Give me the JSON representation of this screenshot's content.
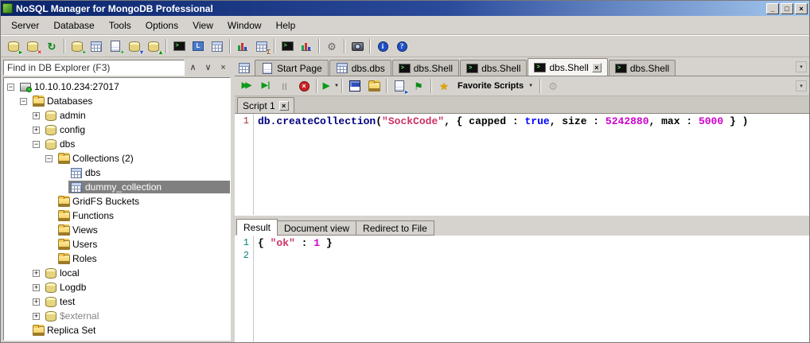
{
  "window": {
    "title": "NoSQL Manager for MongoDB Professional",
    "controls": [
      {
        "name": "minimize",
        "glyph": "_"
      },
      {
        "name": "maximize",
        "glyph": "□"
      },
      {
        "name": "close",
        "glyph": "×"
      }
    ]
  },
  "menu": {
    "items": [
      "Server",
      "Database",
      "Tools",
      "Options",
      "View",
      "Window",
      "Help"
    ]
  },
  "toolbar": {
    "items": [
      {
        "name": "connect-server",
        "base": "db",
        "badge": "▸",
        "badge_color": "#009900"
      },
      {
        "name": "disconnect-server",
        "base": "db",
        "badge": "×",
        "badge_color": "#cc0000"
      },
      {
        "name": "refresh-explorer",
        "base": "refresh",
        "glyph": "↻"
      },
      {
        "sep": true
      },
      {
        "name": "new-database",
        "base": "db",
        "badge": "+",
        "badge_color": "#009900"
      },
      {
        "name": "open-collection",
        "base": "grid"
      },
      {
        "name": "new-query",
        "base": "doc",
        "badge": "+",
        "badge_color": "#009900"
      },
      {
        "name": "import-data",
        "base": "db",
        "badge": "▾",
        "badge_color": "#2255cc"
      },
      {
        "name": "export-data",
        "base": "db",
        "badge": "▴",
        "badge_color": "#009900"
      },
      {
        "sep": true
      },
      {
        "name": "open-shell",
        "base": "monitor",
        "glyph": ">"
      },
      {
        "name": "linq-query",
        "base": "linq",
        "glyph": "L"
      },
      {
        "name": "view-documents",
        "base": "grid"
      },
      {
        "sep": true
      },
      {
        "name": "map-reduce",
        "base": "chart"
      },
      {
        "name": "aggregate",
        "base": "grid",
        "badge": "Σ",
        "badge_color": "#884400"
      },
      {
        "sep": true
      },
      {
        "name": "server-monitoring",
        "base": "monitor",
        "glyph": ">"
      },
      {
        "name": "server-status",
        "base": "chart"
      },
      {
        "sep": true
      },
      {
        "name": "options",
        "base": "gear",
        "glyph": "⚙"
      },
      {
        "sep": true
      },
      {
        "name": "screenshot",
        "base": "camera"
      },
      {
        "sep": true
      },
      {
        "name": "about",
        "base": "info",
        "glyph": "i"
      },
      {
        "name": "help",
        "base": "help",
        "glyph": "?"
      }
    ]
  },
  "explorer": {
    "search_placeholder": "Find in DB Explorer (F3)",
    "buttons": [
      {
        "name": "find-previous",
        "glyph": "∧"
      },
      {
        "name": "find-next",
        "glyph": "∨"
      },
      {
        "name": "search-close",
        "glyph": "×"
      }
    ],
    "tree": [
      {
        "label": "10.10.10.234:27017",
        "icon": "server",
        "expand": "-",
        "depth": 0
      },
      {
        "label": "Databases",
        "icon": "folder",
        "expand": "-",
        "depth": 1
      },
      {
        "label": "admin",
        "icon": "db",
        "expand": "+",
        "depth": 2
      },
      {
        "label": "config",
        "icon": "db",
        "expand": "+",
        "depth": 2
      },
      {
        "label": "dbs",
        "icon": "db",
        "expand": "-",
        "depth": 2
      },
      {
        "label": "Collections (2)",
        "icon": "folder",
        "expand": "-",
        "depth": 3
      },
      {
        "label": "dbs",
        "icon": "grid",
        "depth": 4
      },
      {
        "label": "dummy_collection",
        "icon": "grid",
        "depth": 4,
        "selected": true
      },
      {
        "label": "GridFS Buckets",
        "icon": "folder",
        "depth": 3
      },
      {
        "label": "Functions",
        "icon": "folder",
        "depth": 3
      },
      {
        "label": "Views",
        "icon": "folder",
        "depth": 3
      },
      {
        "label": "Users",
        "icon": "folder",
        "depth": 3
      },
      {
        "label": "Roles",
        "icon": "folder",
        "depth": 3
      },
      {
        "label": "local",
        "icon": "db",
        "expand": "+",
        "depth": 2
      },
      {
        "label": "Logdb",
        "icon": "db",
        "expand": "+",
        "depth": 2
      },
      {
        "label": "test",
        "icon": "db",
        "expand": "+",
        "depth": 2
      },
      {
        "label": "$external",
        "icon": "db",
        "expand": "+",
        "depth": 2,
        "muted": true
      },
      {
        "label": "Replica Set",
        "icon": "folder",
        "depth": 1
      }
    ]
  },
  "tabs": {
    "overflow_glyph": "▾",
    "items": [
      {
        "label": "Start Page",
        "icon": "doc"
      },
      {
        "label": "dbs.dbs",
        "icon": "grid"
      },
      {
        "label": "dbs.Shell",
        "icon": "monitor"
      },
      {
        "label": "dbs.Shell",
        "icon": "monitor"
      },
      {
        "label": "dbs.Shell",
        "icon": "monitor",
        "active": true,
        "closable": true
      },
      {
        "label": "dbs.Shell",
        "icon": "monitor"
      }
    ]
  },
  "shell": {
    "script_tab_label": "Script 1",
    "overflow_glyph": "▾",
    "toolbar": [
      {
        "name": "execute-script",
        "base": "playplay",
        "glyph": "▶▶"
      },
      {
        "name": "execute-statement",
        "base": "playbar",
        "glyph": "▶|"
      },
      {
        "name": "pause-script",
        "base": "pause",
        "glyph": "||"
      },
      {
        "name": "stop-script",
        "base": "stop",
        "glyph": "×"
      },
      {
        "sep": true
      },
      {
        "name": "execute-with-options",
        "base": "play",
        "glyph": "▶",
        "dropdown": true
      },
      {
        "sep": true
      },
      {
        "name": "save-script",
        "base": "floppy"
      },
      {
        "name": "open-script",
        "base": "folder"
      },
      {
        "sep": true
      },
      {
        "name": "export-result",
        "base": "doc",
        "badge": "▸",
        "badge_color": "#2255cc"
      },
      {
        "name": "run-to-flag",
        "base": "flag",
        "glyph": "⚑"
      },
      {
        "sep": true
      },
      {
        "name": "add-to-favorites",
        "base": "star",
        "glyph": "★"
      },
      {
        "name": "favorite-scripts",
        "label": "Favorite Scripts",
        "dropdown": true
      },
      {
        "sep": true
      },
      {
        "name": "shell-options",
        "base": "gear",
        "glyph": "⚙",
        "disabled": true
      }
    ]
  },
  "editor": {
    "line_numbers": [
      "1"
    ],
    "tokens": [
      {
        "t": "db.createCollection",
        "c": "ident"
      },
      {
        "t": "(",
        "c": "plain"
      },
      {
        "t": "\"SockCode\"",
        "c": "string"
      },
      {
        "t": ", { capped : ",
        "c": "plain"
      },
      {
        "t": "true",
        "c": "keyword"
      },
      {
        "t": ", size : ",
        "c": "plain"
      },
      {
        "t": "5242880",
        "c": "number"
      },
      {
        "t": ", max : ",
        "c": "plain"
      },
      {
        "t": "5000",
        "c": "number"
      },
      {
        "t": " } )",
        "c": "plain"
      }
    ]
  },
  "result": {
    "tabs": [
      {
        "label": "Result",
        "active": true
      },
      {
        "label": "Document view"
      },
      {
        "label": "Redirect to File"
      }
    ],
    "line_numbers": [
      "1",
      "2"
    ],
    "tokens": [
      {
        "t": "{ ",
        "c": "plain"
      },
      {
        "t": "\"ok\"",
        "c": "string"
      },
      {
        "t": " : ",
        "c": "plain"
      },
      {
        "t": "1",
        "c": "number"
      },
      {
        "t": " }",
        "c": "plain"
      }
    ]
  },
  "colors": {
    "titlebar_left": "#0a246a",
    "titlebar_right": "#a6caf0",
    "chrome": "#d6d3ce",
    "selection_bg": "#808080",
    "syntax_ident": "#000080",
    "syntax_string": "#cc3366",
    "syntax_number": "#cc00cc",
    "syntax_keyword": "#0000ff"
  }
}
